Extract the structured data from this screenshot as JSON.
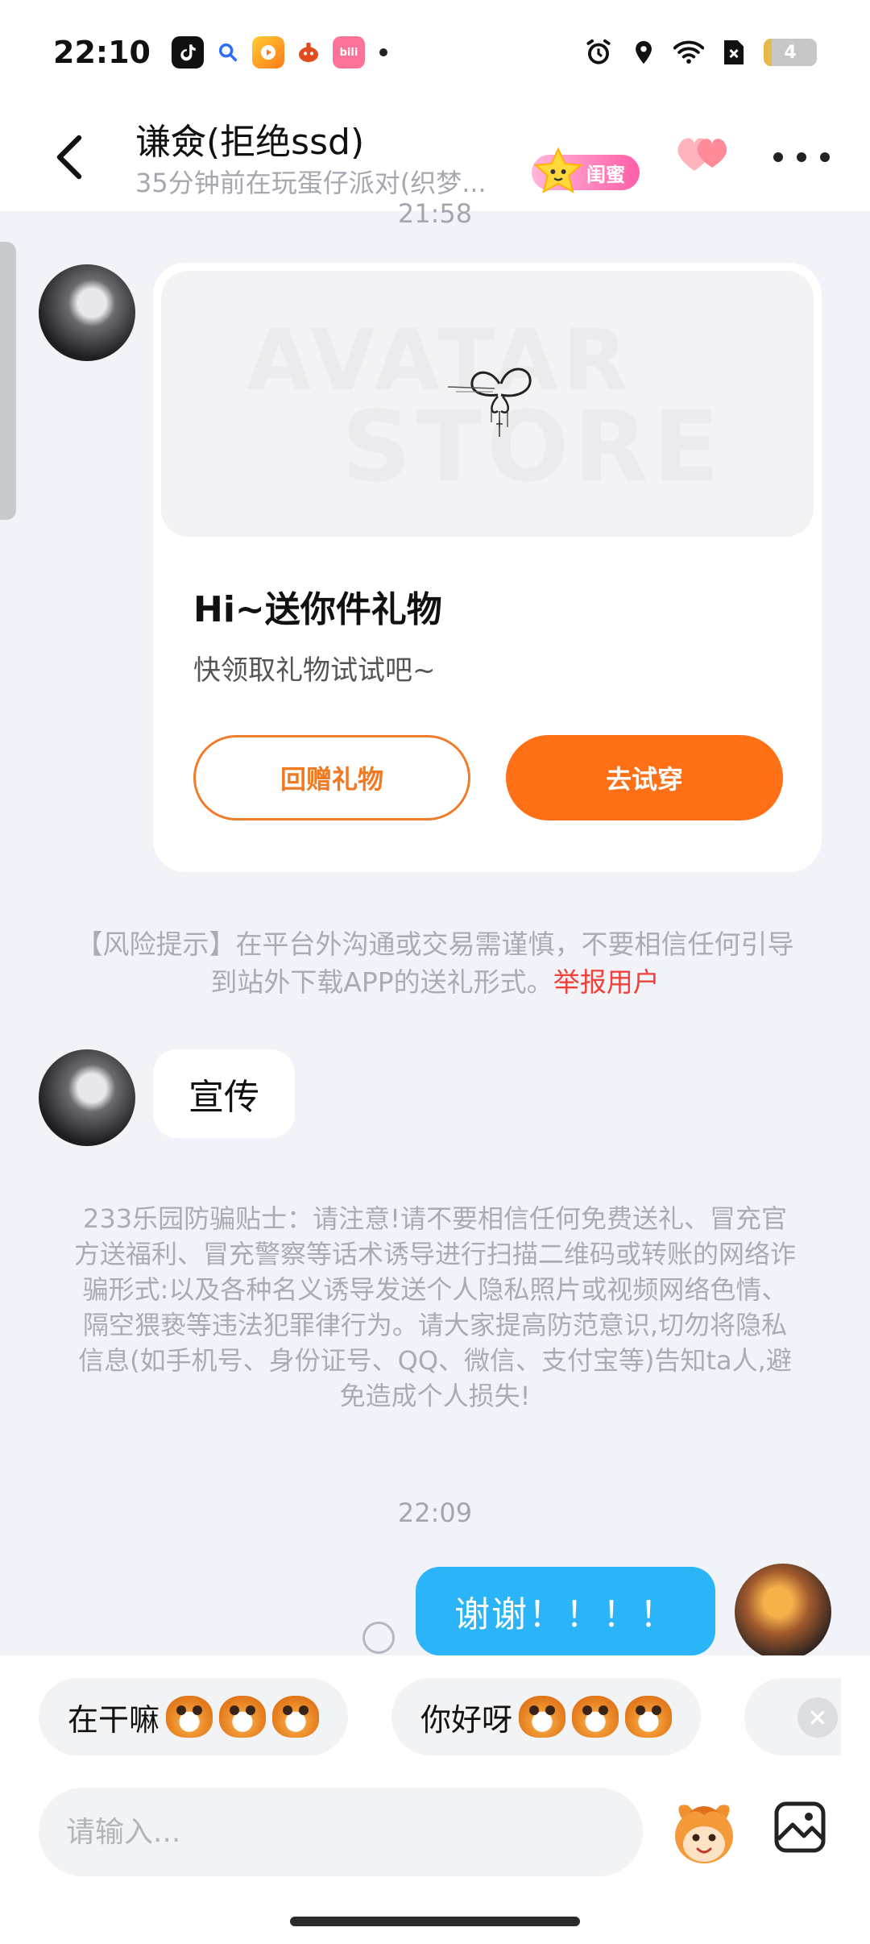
{
  "status_bar": {
    "time": "22:10",
    "app_icons": [
      "tiktok-icon",
      "search-app-icon",
      "video-app-icon",
      "game-app-icon",
      "bilibili-app-icon"
    ],
    "battery_level": "4"
  },
  "header": {
    "back_icon": "chevron-left-icon",
    "contact_name": "谦僉(拒绝ssd)",
    "contact_status": "35分钟前在玩蛋仔派对(织梦...",
    "relationship_badge": "闺蜜",
    "more_icon": "more-dots-icon"
  },
  "messages": {
    "timestamp_top": "21:58",
    "gift_card": {
      "title": "Hi~送你件礼物",
      "subtitle": "快领取礼物试试吧~",
      "return_gift_label": "回赠礼物",
      "try_on_label": "去试穿",
      "watermark_line1": "AVATAR",
      "watermark_line2": "STORE"
    },
    "risk_notice_text": "【风险提示】在平台外沟通或交易需谨慎，不要相信任何引导到站外下载APP的送礼形式。",
    "report_link": "举报用户",
    "incoming_text": "宣传",
    "fraud_tip": "233乐园防骗贴士：请注意!请不要相信任何免费送礼、冒充官方送福利、冒充警察等话术诱导进行扫描二维码或转账的网络诈骗形式:以及各种名义诱导发送个人隐私照片或视频网络色情、隔空猥亵等违法犯罪律行为。请大家提高防范意识,切勿将隐私信息(如手机号、身份证号、QQ、微信、支付宝等)告知ta人,避免造成个人损失!",
    "timestamp_bottom": "22:09",
    "outgoing_text": "谢谢！！！！"
  },
  "quick_replies": [
    {
      "label": "在干嘛",
      "emoji_icon": "monkey-grin-emoji"
    },
    {
      "label": "你好呀",
      "emoji_icon": "monkey-wow-emoji"
    }
  ],
  "composer": {
    "placeholder": "请输入...",
    "mascot_icon": "mascot-emoji-icon",
    "image_icon": "image-icon"
  },
  "colors": {
    "accent_orange": "#ff6f16",
    "outgoing_bubble": "#2cb4f8",
    "report_red": "#f0413a",
    "background": "#f1f3f8"
  }
}
